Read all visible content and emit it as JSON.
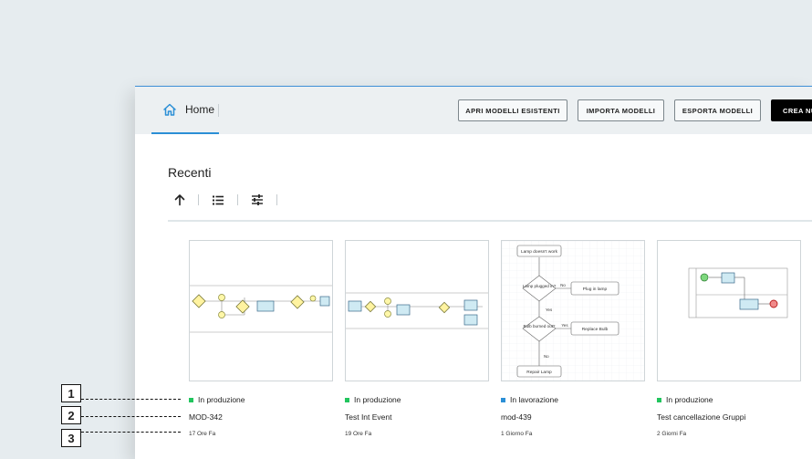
{
  "header": {
    "home_label": "Home",
    "buttons": {
      "open_existing": "APRI MODELLI ESISTENTI",
      "import": "IMPORTA MODELLI",
      "export": "ESPORTA MODELLI",
      "create_new": "CREA NU"
    }
  },
  "section": {
    "title": "Recenti"
  },
  "toolbar": {
    "icons": [
      "sort-ascending-icon",
      "list-view-icon",
      "filter-settings-icon"
    ]
  },
  "cards": [
    {
      "status": "In produzione",
      "status_color": "#22c55e",
      "name": "MOD-342",
      "time": "17 Ore Fa"
    },
    {
      "status": "In produzione",
      "status_color": "#22c55e",
      "name": "Test Int Event",
      "time": "19 Ore Fa"
    },
    {
      "status": "In lavorazione",
      "status_color": "#2b8fd6",
      "name": "mod-439",
      "time": "1 Giorno Fa"
    },
    {
      "status": "In produzione",
      "status_color": "#22c55e",
      "name": "Test cancellazione Gruppi",
      "time": "2 Giorni Fa"
    }
  ],
  "flowchart": {
    "start": "Lamp doesn't work",
    "q1": "Lamp plugged in?",
    "q1_no": "No",
    "a1": "Plug in lamp",
    "q1_yes": "Yes",
    "q2": "Bulb burned out?",
    "q2_yes": "Yes",
    "a2": "Replace Bulb",
    "q2_no": "No",
    "end": "Repair Lamp"
  },
  "annotations": [
    "1",
    "2",
    "3"
  ]
}
